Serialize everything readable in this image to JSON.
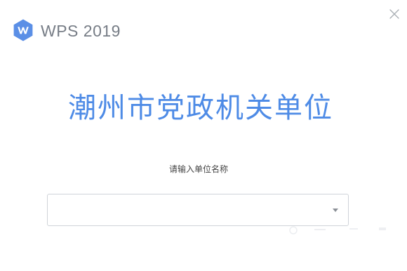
{
  "header": {
    "app_title": "WPS 2019",
    "logo_icon": "wps-logo-icon",
    "close_icon": "close-icon"
  },
  "main": {
    "headline": "潮州市党政机关单位",
    "prompt": "请输入单位名称",
    "unit_select": {
      "value": "",
      "arrow_icon": "chevron-down-icon"
    }
  },
  "colors": {
    "accent": "#4e8be6",
    "logo": "#5b8fe6",
    "title_gray": "#777d86"
  }
}
